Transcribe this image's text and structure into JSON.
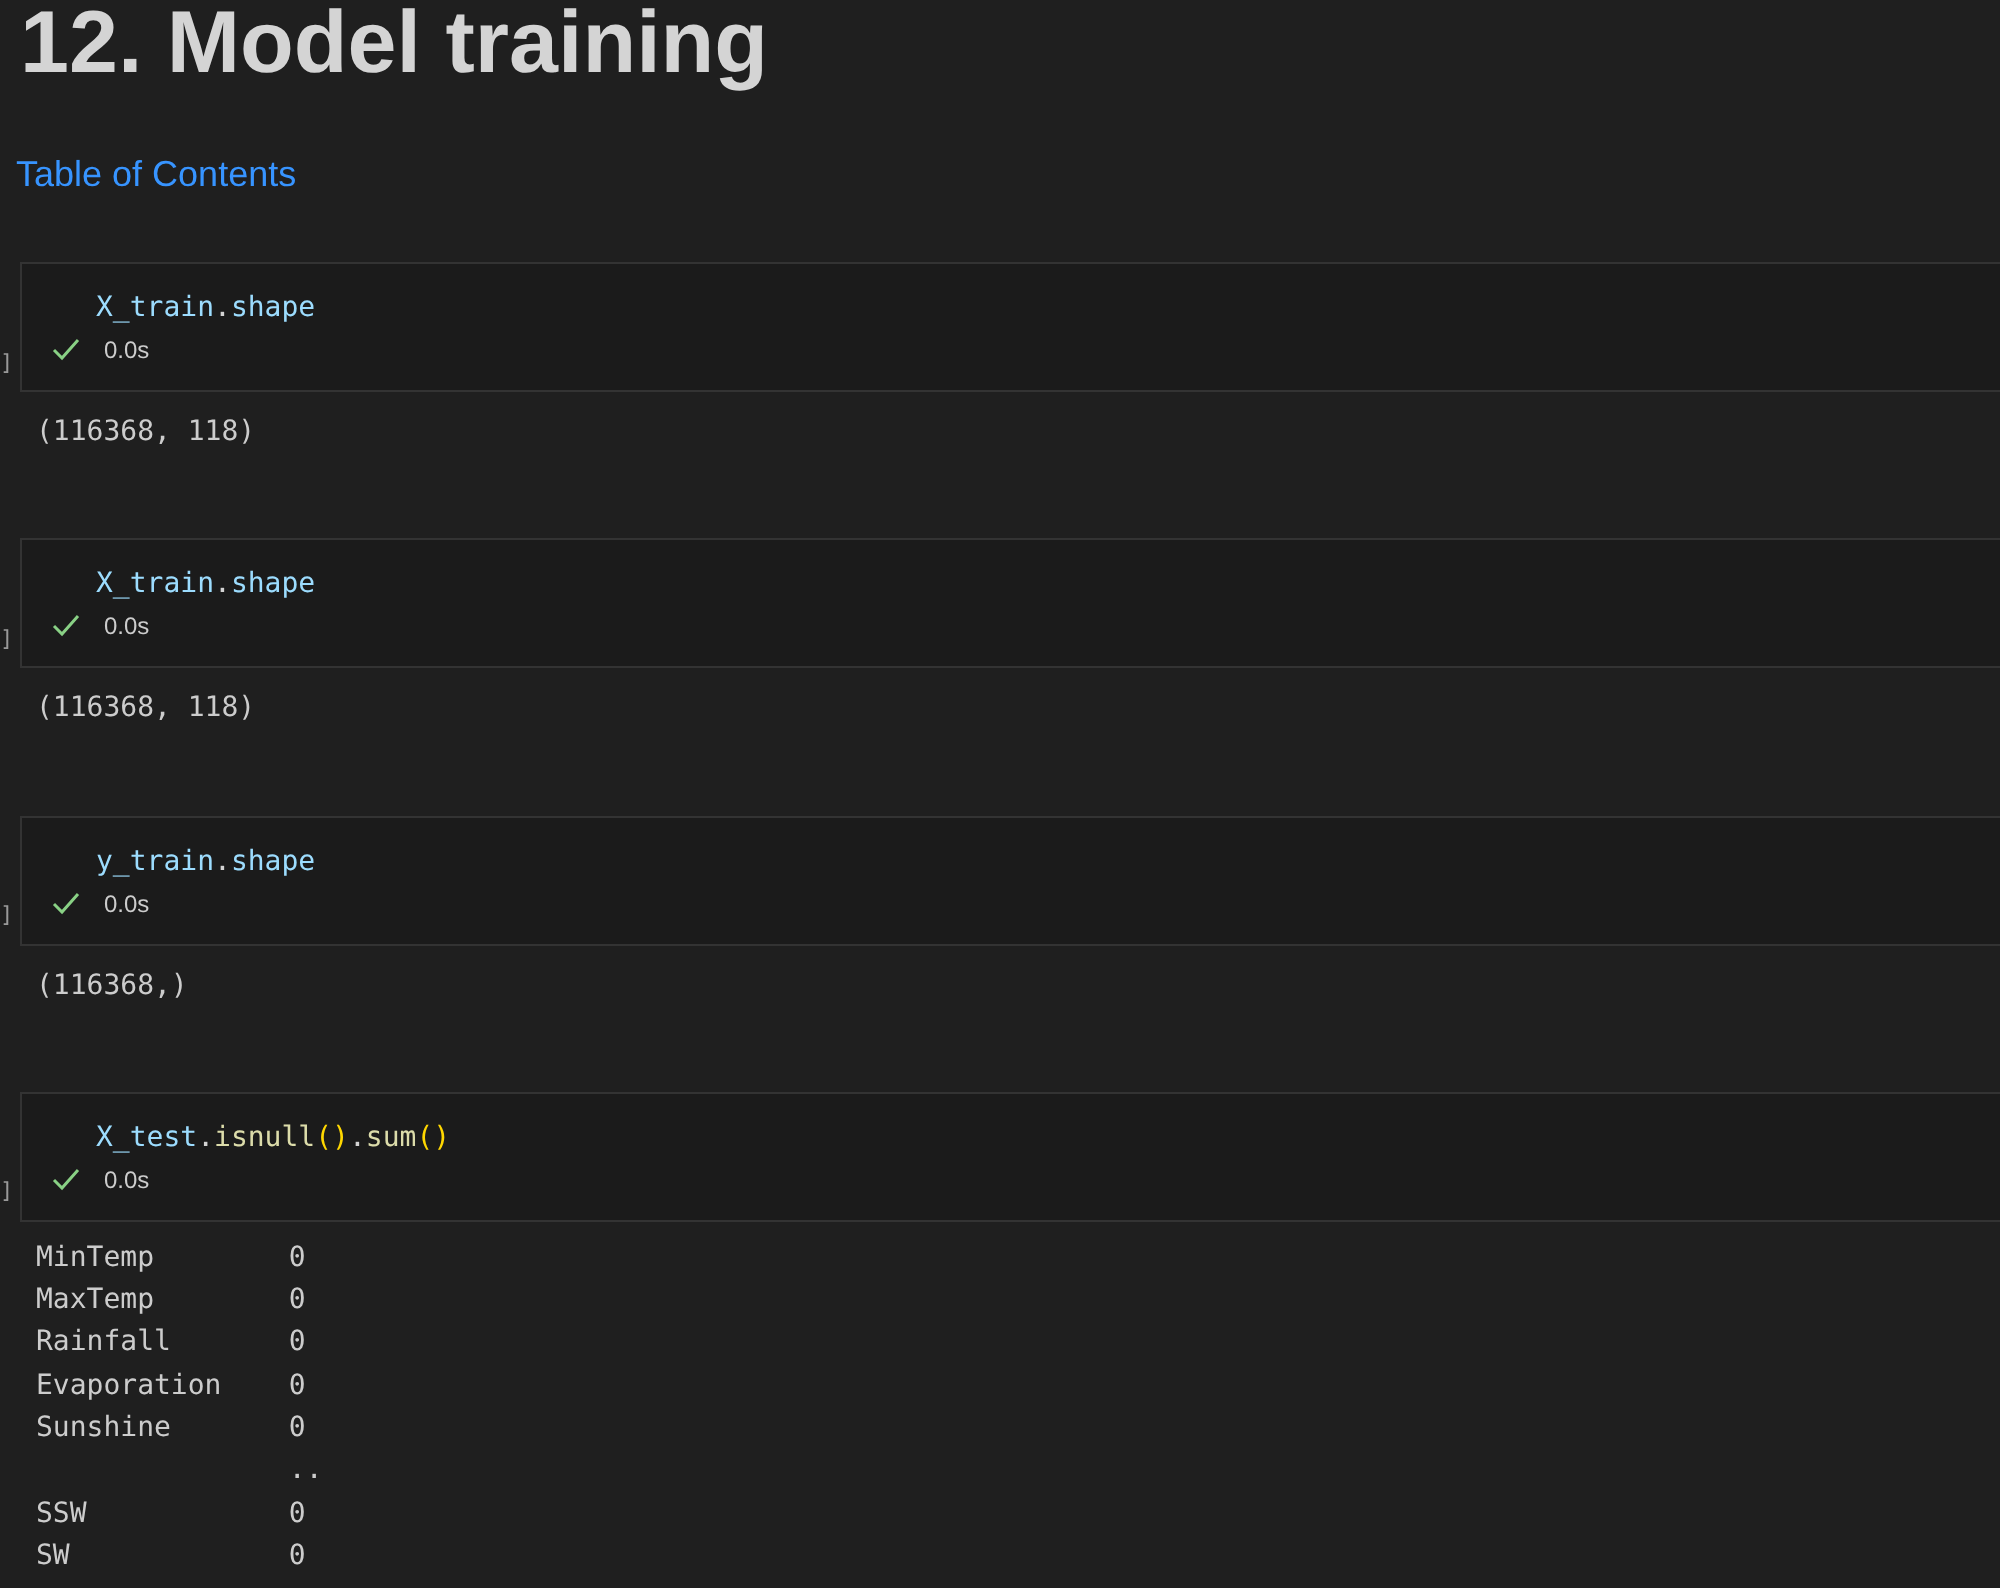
{
  "heading": "12. Model training",
  "toc_link": "Table of Contents",
  "cells": [
    {
      "exec_label": "]",
      "code": [
        {
          "kind": "var",
          "text": "X_train"
        },
        {
          "kind": "plain",
          "text": "."
        },
        {
          "kind": "var",
          "text": "shape"
        }
      ],
      "time": "0.0s",
      "output": [
        "(116368, 118)"
      ]
    },
    {
      "exec_label": "]",
      "code": [
        {
          "kind": "var",
          "text": "X_train"
        },
        {
          "kind": "plain",
          "text": "."
        },
        {
          "kind": "var",
          "text": "shape"
        }
      ],
      "time": "0.0s",
      "output": [
        "(116368, 118)"
      ]
    },
    {
      "exec_label": "]",
      "code": [
        {
          "kind": "var",
          "text": "y_train"
        },
        {
          "kind": "plain",
          "text": "."
        },
        {
          "kind": "var",
          "text": "shape"
        }
      ],
      "time": "0.0s",
      "output": [
        "(116368,)"
      ]
    },
    {
      "exec_label": "]",
      "code": [
        {
          "kind": "var",
          "text": "X_test"
        },
        {
          "kind": "plain",
          "text": "."
        },
        {
          "kind": "func",
          "text": "isnull"
        },
        {
          "kind": "bracket",
          "text": "()"
        },
        {
          "kind": "plain",
          "text": "."
        },
        {
          "kind": "func",
          "text": "sum"
        },
        {
          "kind": "bracket",
          "text": "()"
        }
      ],
      "time": "0.0s",
      "output": [
        "MinTemp        0",
        "MaxTemp        0",
        "Rainfall       0",
        "Evaporation    0",
        "Sunshine       0",
        "               ..",
        "SSW            0",
        "SW             0"
      ]
    }
  ]
}
